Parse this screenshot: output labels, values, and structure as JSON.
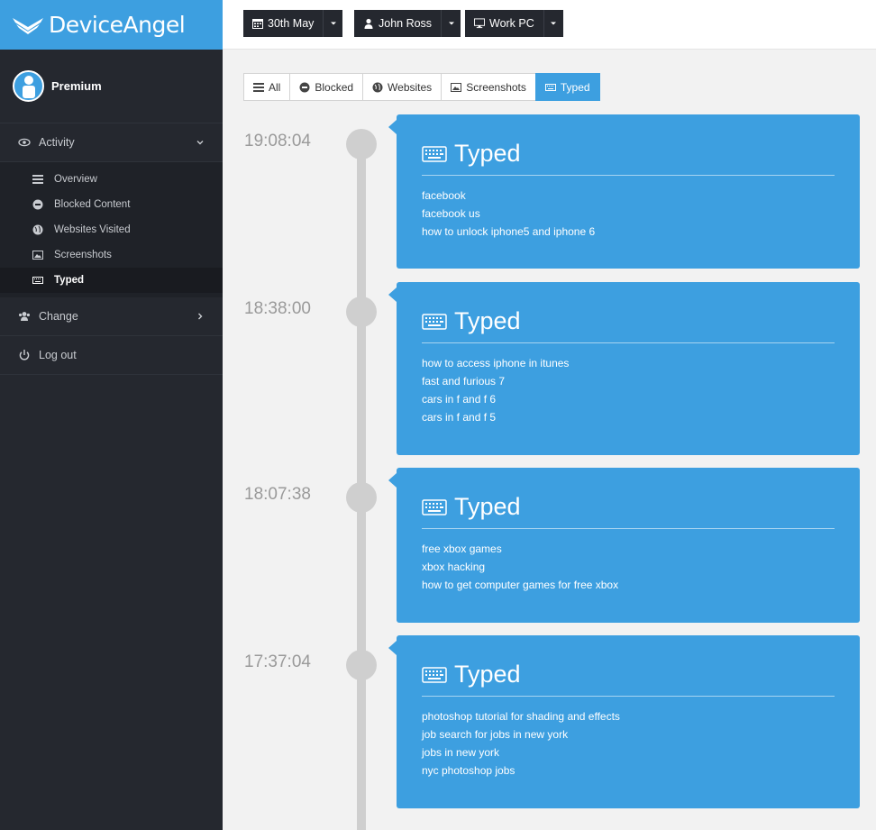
{
  "brand": {
    "name": "DeviceAngel"
  },
  "user": {
    "label": "Premium"
  },
  "sidebar": {
    "activity_label": "Activity",
    "items": [
      {
        "label": "Overview",
        "icon": "list-icon"
      },
      {
        "label": "Blocked Content",
        "icon": "minus-circle-icon"
      },
      {
        "label": "Websites Visited",
        "icon": "globe-icon"
      },
      {
        "label": "Screenshots",
        "icon": "image-icon"
      },
      {
        "label": "Typed",
        "icon": "keyboard-icon",
        "active": true
      }
    ],
    "change_label": "Change",
    "logout_label": "Log out"
  },
  "topbar": {
    "date": "30th May",
    "user": "John Ross",
    "device": "Work PC"
  },
  "filters": [
    {
      "label": "All",
      "icon": "list-icon"
    },
    {
      "label": "Blocked",
      "icon": "minus-circle-icon"
    },
    {
      "label": "Websites",
      "icon": "globe-icon"
    },
    {
      "label": "Screenshots",
      "icon": "image-icon"
    },
    {
      "label": "Typed",
      "icon": "keyboard-icon",
      "active": true
    }
  ],
  "colors": {
    "accent": "#3d9fe0",
    "sidebar": "#25282f",
    "timeline": "#cfcfcf"
  },
  "entries": [
    {
      "time": "19:08:04",
      "title": "Typed",
      "lines": [
        "facebook",
        "facebook us",
        "how to unlock iphone5 and iphone 6"
      ]
    },
    {
      "time": "18:38:00",
      "title": "Typed",
      "lines": [
        "how to access iphone in itunes",
        "fast and furious 7",
        "cars in f and f 6",
        "cars in f and f 5"
      ]
    },
    {
      "time": "18:07:38",
      "title": "Typed",
      "lines": [
        "free xbox games",
        "xbox hacking",
        "how to get computer games for free xbox"
      ]
    },
    {
      "time": "17:37:04",
      "title": "Typed",
      "lines": [
        "photoshop tutorial for shading and effects",
        "job search for jobs in new york",
        "jobs in new york",
        "nyc photoshop jobs"
      ]
    }
  ]
}
